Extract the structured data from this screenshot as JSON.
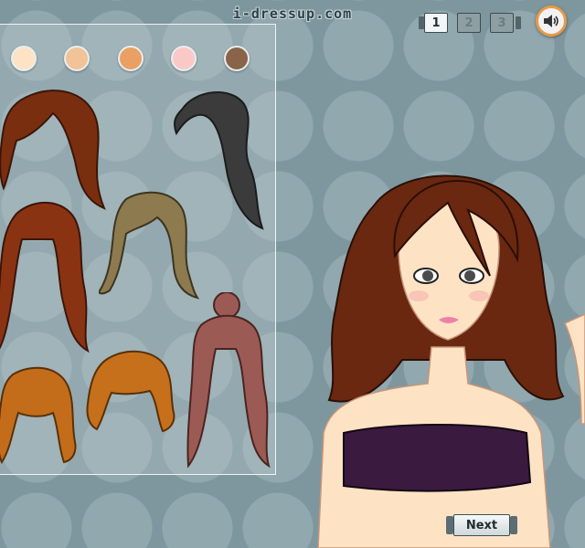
{
  "header": {
    "site_title": "i-dressup.com"
  },
  "page_nav": {
    "pages": [
      "1",
      "2",
      "3"
    ],
    "active_page": "1"
  },
  "sound": {
    "icon": "speaker-icon"
  },
  "skin_tones": [
    "#fde3c4",
    "#f1c397",
    "#e9a062",
    "#fac9c7",
    "#8a6448"
  ],
  "hair_options": [
    {
      "color": "#7a2e10"
    },
    {
      "color": "#3b3b3b"
    },
    {
      "color": "#8a3313"
    },
    {
      "color": "#8d7a4e"
    },
    {
      "color": "#9c5a55"
    },
    {
      "color": "#c36d1a"
    },
    {
      "color": "#c6701c"
    }
  ],
  "model": {
    "hair_color": "#6a2810",
    "top_color": "#3b1a40",
    "skin": "#fde3c4"
  },
  "footer": {
    "next_label": "Next"
  }
}
